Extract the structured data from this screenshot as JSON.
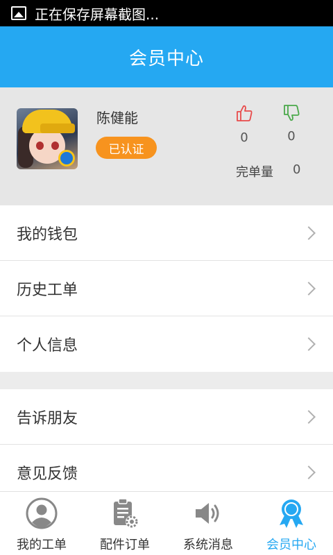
{
  "status_bar": {
    "text": "正在保存屏幕截图..."
  },
  "header": {
    "title": "会员中心"
  },
  "profile": {
    "name": "陈健能",
    "badge": "已认证",
    "likes": "0",
    "dislikes": "0",
    "completed_label": "完单量",
    "completed_count": "0"
  },
  "menu": {
    "group1": [
      {
        "label": "我的钱包"
      },
      {
        "label": "历史工单"
      },
      {
        "label": "个人信息"
      }
    ],
    "group2": [
      {
        "label": "告诉朋友"
      },
      {
        "label": "意见反馈"
      }
    ]
  },
  "tabs": [
    {
      "label": "我的工单",
      "icon": "person-icon"
    },
    {
      "label": "配件订单",
      "icon": "clipboard-gear-icon"
    },
    {
      "label": "系统消息",
      "icon": "speaker-icon"
    },
    {
      "label": "会员中心",
      "icon": "ribbon-badge-icon",
      "active": true
    }
  ],
  "colors": {
    "accent": "#25a8f2",
    "badge": "#f7931e",
    "like": "#e84a4a",
    "dislike": "#4aa84a"
  }
}
